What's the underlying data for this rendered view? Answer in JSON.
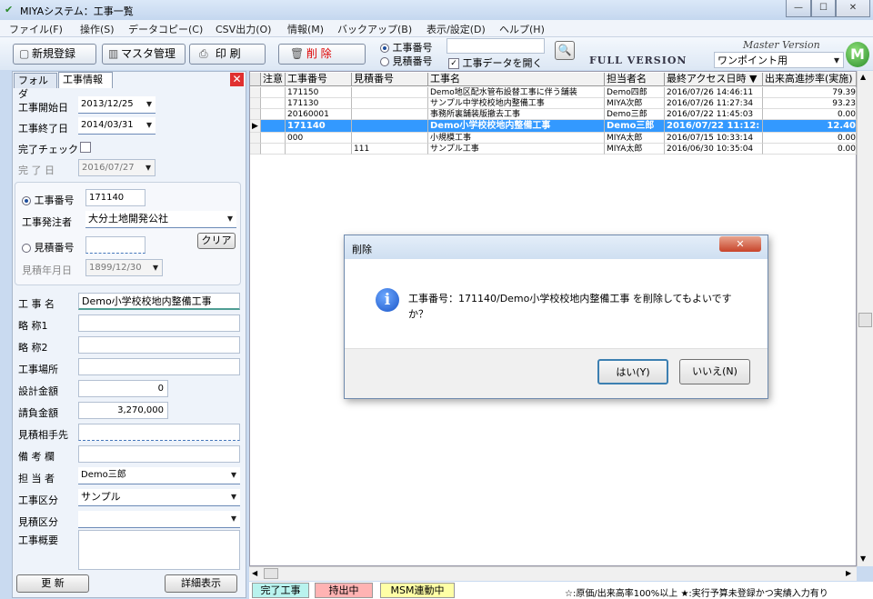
{
  "window": {
    "title": "MIYAシステム：工事一覧",
    "minimize": "—",
    "maximize": "☐",
    "close": "✕"
  },
  "menu": [
    "ファイル(F)",
    "操作(S)",
    "データコピー(C)",
    "CSV出力(O)",
    "情報(M)",
    "バックアップ(B)",
    "表示/設定(D)",
    "ヘルプ(H)"
  ],
  "toolbar": {
    "new": "新規登録",
    "master": "マスタ管理",
    "print": "印 刷",
    "delete": "削 除",
    "radio_koji": "工事番号",
    "radio_mitsumori": "見積番号",
    "open_data": "工事データを開く",
    "full_version": "FULL VERSION",
    "master_version": "Master Version",
    "onepoint": "ワンポイント用",
    "logo": "M"
  },
  "left": {
    "tab_folder": "フォルダ",
    "tab_info": "工事情報",
    "start_label": "工事開始日",
    "start_value": "2013/12/25",
    "end_label": "工事終了日",
    "end_value": "2014/03/31",
    "done_check": "完了チェック",
    "done_date_label": "完 了 日",
    "done_date_value": "2016/07/27",
    "koji_no_label": "工事番号",
    "koji_no_value": "171140",
    "orderer_label": "工事発注者",
    "orderer_value": "大分土地開発公社",
    "mitsu_no_label": "見積番号",
    "clear": "クリア",
    "mitsu_date_label": "見積年月日",
    "mitsu_date_value": "1899/12/30",
    "name_label": "工 事 名",
    "name_value": "Demo小学校校地内整備工事",
    "abbr1_label": "略 称1",
    "abbr2_label": "略 称2",
    "place_label": "工事場所",
    "design_label": "設計金額",
    "design_value": "0",
    "contract_label": "請負金額",
    "contract_value": "3,270,000",
    "partner_label": "見積相手先",
    "note_label": "備 考 欄",
    "person_label": "担 当 者",
    "person_value": "Demo三郎",
    "kubun_label": "工事区分",
    "kubun_value": "サンプル",
    "mkubun_label": "見積区分",
    "summary_label": "工事概要",
    "update": "更 新",
    "detail": "詳細表示"
  },
  "grid": {
    "headers": [
      "注意",
      "工事番号",
      "見積番号",
      "工事名",
      "担当者名",
      "最終アクセス日時 ▼",
      "出来高進捗率(実施)"
    ],
    "rows": [
      [
        "",
        "171150",
        "",
        "Demo地区配水管布設替工事に伴う舗装",
        "Demo四郎",
        "2016/07/26 14:46:11",
        "79.39"
      ],
      [
        "",
        "171130",
        "",
        "サンプル中学校校地内整備工事",
        "MIYA次郎",
        "2016/07/26 11:27:34",
        "93.23"
      ],
      [
        "",
        "20160001",
        "",
        "事務所裏舗装版撤去工事",
        "Demo三郎",
        "2016/07/22 11:45:03",
        "0.00"
      ],
      [
        "▶",
        "171140",
        "",
        "Demo小学校校地内整備工事",
        "Demo三郎",
        "2016/07/22 11:12:",
        "12.40"
      ],
      [
        "",
        "000",
        "",
        "小規模工事",
        "MIYA太郎",
        "2016/07/15 10:33:14",
        "0.00"
      ],
      [
        "",
        "",
        "111",
        "サンプル工事",
        "MIYA太郎",
        "2016/06/30 10:35:04",
        "0.00"
      ]
    ]
  },
  "legend": {
    "done": "完了工事",
    "carried": "持出中",
    "msm": "MSM連動中",
    "note": "☆:原価/出来高率100%以上 ★:実行予算未登録かつ実績入力有り"
  },
  "dialog": {
    "title": "削除",
    "message": "工事番号：171140/Demo小学校校地内整備工事 を削除してもよいですか？",
    "yes": "はい(Y)",
    "no": "いいえ(N)",
    "close": "✕"
  },
  "colors": {
    "selected_row": "#3399ff",
    "legend_done": "#b9f3ee",
    "legend_carried": "#ffb3b3",
    "legend_msm": "#ffffa6"
  }
}
